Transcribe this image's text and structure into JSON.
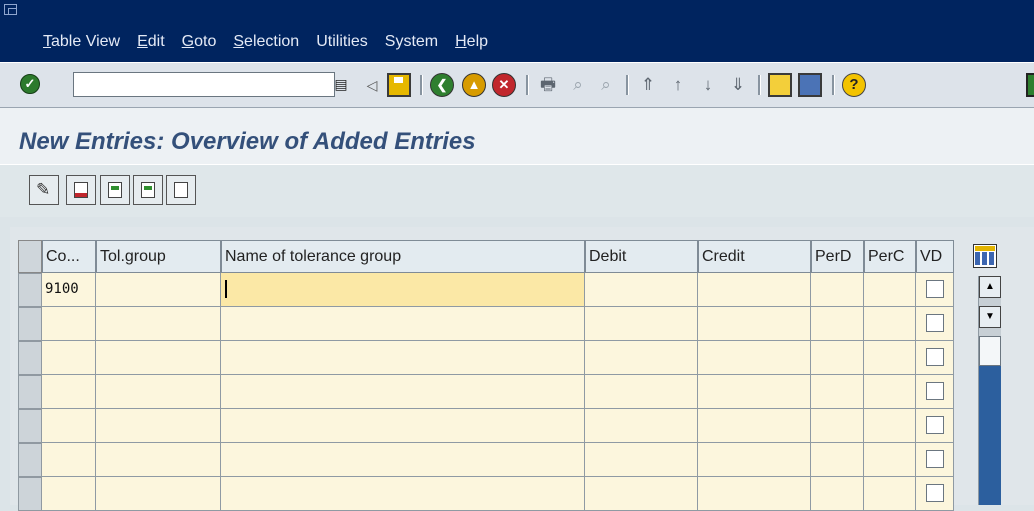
{
  "menu": {
    "items": [
      {
        "hot": "T",
        "rest": "able View"
      },
      {
        "hot": "E",
        "rest": "dit"
      },
      {
        "hot": "G",
        "rest": "oto"
      },
      {
        "hot": "S",
        "rest": "election"
      },
      {
        "hot": "",
        "rest": "Utilities"
      },
      {
        "hot": "",
        "rest": "System"
      },
      {
        "hot": "H",
        "rest": "elp"
      }
    ]
  },
  "toolbar": {
    "command_field_value": "",
    "icons": [
      "enter-icon",
      "command-dropdown-icon",
      "back-arrow-icon",
      "save-icon",
      "back-icon",
      "exit-icon",
      "cancel-icon",
      "print-icon",
      "find-icon",
      "find-next-icon",
      "first-page-icon",
      "previous-page-icon",
      "next-page-icon",
      "last-page-icon",
      "create-session-icon",
      "shortcut-icon",
      "help-icon"
    ]
  },
  "title": "New Entries: Overview of Added Entries",
  "app_toolbar": {
    "icons": [
      "change-display-icon",
      "delete-icon",
      "select-all-icon",
      "select-block-icon",
      "deselect-all-icon"
    ]
  },
  "table": {
    "columns": [
      "Co...",
      "Tol.group",
      "Name of tolerance group",
      "Debit",
      "Credit",
      "PerD",
      "PerC",
      "VD"
    ],
    "rows": [
      {
        "company": "9100",
        "tol_group": "",
        "name": "",
        "debit": "",
        "credit": "",
        "perd": "",
        "perc": "",
        "vd": false
      },
      {
        "company": "",
        "tol_group": "",
        "name": "",
        "debit": "",
        "credit": "",
        "perd": "",
        "perc": "",
        "vd": false
      },
      {
        "company": "",
        "tol_group": "",
        "name": "",
        "debit": "",
        "credit": "",
        "perd": "",
        "perc": "",
        "vd": false
      },
      {
        "company": "",
        "tol_group": "",
        "name": "",
        "debit": "",
        "credit": "",
        "perd": "",
        "perc": "",
        "vd": false
      },
      {
        "company": "",
        "tol_group": "",
        "name": "",
        "debit": "",
        "credit": "",
        "perd": "",
        "perc": "",
        "vd": false
      },
      {
        "company": "",
        "tol_group": "",
        "name": "",
        "debit": "",
        "credit": "",
        "perd": "",
        "perc": "",
        "vd": false
      },
      {
        "company": "",
        "tol_group": "",
        "name": "",
        "debit": "",
        "credit": "",
        "perd": "",
        "perc": "",
        "vd": false
      }
    ],
    "scroll_up_glyph": "▲",
    "scroll_down_glyph": "▼"
  },
  "colors": {
    "menubar": "#00245f",
    "title": "#34507a",
    "cell_bg": "#fcf6dd",
    "focus_cell": "#fbe8a6"
  }
}
